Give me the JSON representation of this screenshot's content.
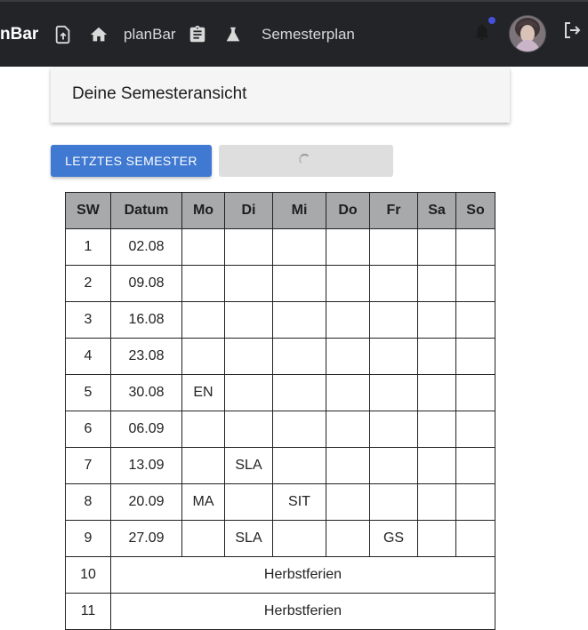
{
  "nav": {
    "brand": "nBar",
    "link_planbar": "planBar",
    "link_semesterplan": "Semesterplan",
    "icons": [
      "upload-file-icon",
      "home-icon",
      "clipboard-icon",
      "flask-icon",
      "bell-icon",
      "avatar",
      "logout-icon"
    ],
    "notification_dot_color": "#4650d8"
  },
  "card": {
    "title": "Deine Semesteransicht"
  },
  "buttons": {
    "previous_semester": "LETZTES SEMESTER"
  },
  "table": {
    "headers": [
      "SW",
      "Datum",
      "Mo",
      "Di",
      "Mi",
      "Do",
      "Fr",
      "Sa",
      "So"
    ],
    "rows": [
      {
        "sw": "1",
        "datum": "02.08",
        "mo": "",
        "di": "",
        "mi": "",
        "do": "",
        "fr": "",
        "sa": "",
        "so": ""
      },
      {
        "sw": "2",
        "datum": "09.08",
        "mo": "",
        "di": "",
        "mi": "",
        "do": "",
        "fr": "",
        "sa": "",
        "so": ""
      },
      {
        "sw": "3",
        "datum": "16.08",
        "mo": "",
        "di": "",
        "mi": "",
        "do": "",
        "fr": "",
        "sa": "",
        "so": ""
      },
      {
        "sw": "4",
        "datum": "23.08",
        "mo": "",
        "di": "",
        "mi": "",
        "do": "",
        "fr": "",
        "sa": "",
        "so": ""
      },
      {
        "sw": "5",
        "datum": "30.08",
        "mo": "EN",
        "di": "",
        "mi": "",
        "do": "",
        "fr": "",
        "sa": "",
        "so": ""
      },
      {
        "sw": "6",
        "datum": "06.09",
        "mo": "",
        "di": "",
        "mi": "",
        "do": "",
        "fr": "",
        "sa": "",
        "so": ""
      },
      {
        "sw": "7",
        "datum": "13.09",
        "mo": "",
        "di": "SLA",
        "mi": "",
        "do": "",
        "fr": "",
        "sa": "",
        "so": ""
      },
      {
        "sw": "8",
        "datum": "20.09",
        "mo": "MA",
        "di": "",
        "mi": "SIT",
        "do": "",
        "fr": "",
        "sa": "",
        "so": ""
      },
      {
        "sw": "9",
        "datum": "27.09",
        "mo": "",
        "di": "SLA",
        "mi": "",
        "do": "",
        "fr": "GS",
        "sa": "",
        "so": ""
      }
    ],
    "holiday_rows": [
      {
        "sw": "10",
        "label": "Herbstferien"
      },
      {
        "sw": "11",
        "label": "Herbstferien"
      }
    ],
    "header_bg": "#a7a9ab"
  },
  "colors": {
    "topbar": "#222428",
    "primary_button": "#3f79d1"
  }
}
